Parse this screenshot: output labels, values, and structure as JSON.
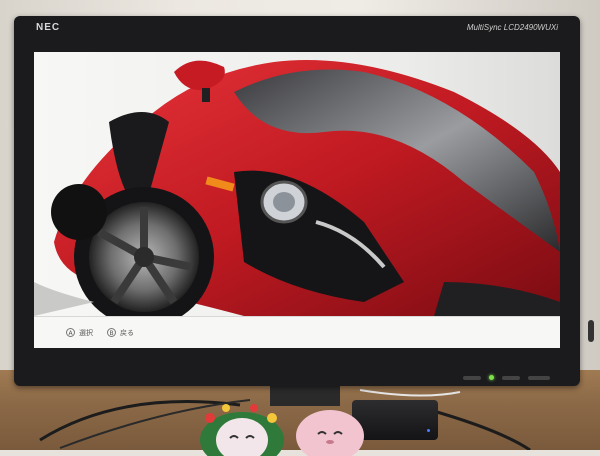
{
  "monitor": {
    "brand": "NEC",
    "model": "MultiSync LCD2490WUXi",
    "power_led_color": "#7de14a"
  },
  "screen": {
    "image_subject": "red-sports-car-closeup",
    "bottom_bar": {
      "hints": [
        {
          "button": "A",
          "label": "選択"
        },
        {
          "button": "B",
          "label": "戻る"
        }
      ]
    }
  }
}
